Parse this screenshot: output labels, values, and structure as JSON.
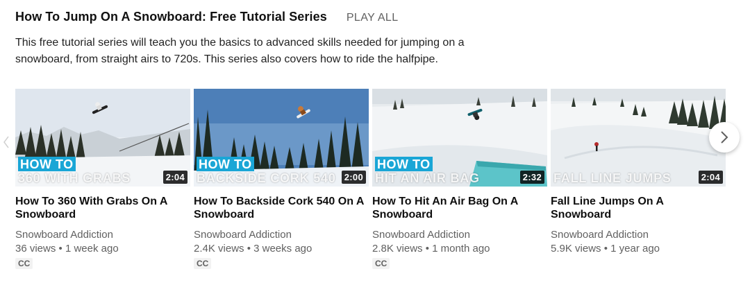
{
  "shelf": {
    "title": "How To Jump On A Snowboard: Free Tutorial Series",
    "play_all": "PLAY ALL",
    "description": "This free tutorial series will teach you the basics to advanced skills needed for jumping on a snowboard, from straight airs to 720s. This series also covers how to ride the halfpipe."
  },
  "videos": [
    {
      "title": "How To 360 With Grabs On A Snowboard",
      "channel": "Snowboard Addiction",
      "stats": "36 views • 1 week ago",
      "cc": "CC",
      "duration": "2:04",
      "overlay_top": "HOW TO",
      "overlay_bottom": "360 WITH GRABS"
    },
    {
      "title": "How To Backside Cork 540 On A Snowboard",
      "channel": "Snowboard Addiction",
      "stats": "2.4K views • 3 weeks ago",
      "cc": "CC",
      "duration": "2:00",
      "overlay_top": "HOW TO",
      "overlay_bottom": "BACKSIDE CORK 540"
    },
    {
      "title": "How To Hit An Air Bag On A Snowboard",
      "channel": "Snowboard Addiction",
      "stats": "2.8K views • 1 month ago",
      "cc": "CC",
      "duration": "2:32",
      "overlay_top": "HOW TO",
      "overlay_bottom": "HIT AN AIR BAG"
    },
    {
      "title": "Fall Line Jumps On A Snowboard",
      "channel": "Snowboard Addiction",
      "stats": "5.9K views • 1 year ago",
      "duration": "2:04",
      "overlay_bottom": "FALL LINE JUMPS"
    }
  ],
  "icons": {
    "next": "chevron-right-icon",
    "prev": "chevron-left-icon"
  },
  "colors": {
    "overlay_accent": "#1aa6d6",
    "duration_bg": "#000000",
    "secondary_text": "#606060"
  }
}
